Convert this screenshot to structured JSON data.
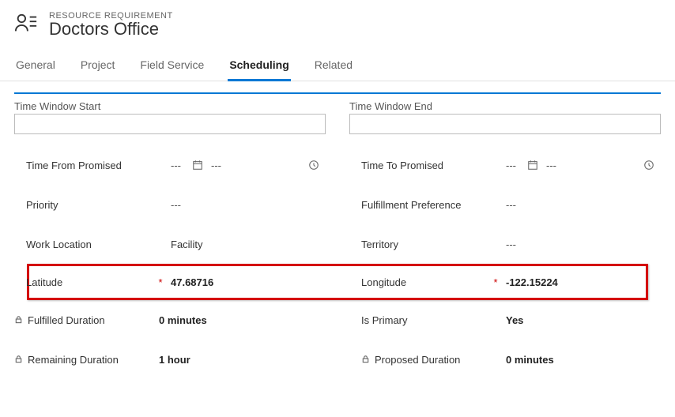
{
  "header": {
    "eyebrow": "RESOURCE REQUIREMENT",
    "title": "Doctors Office"
  },
  "tabs": [
    {
      "label": "General",
      "active": false
    },
    {
      "label": "Project",
      "active": false
    },
    {
      "label": "Field Service",
      "active": false
    },
    {
      "label": "Scheduling",
      "active": true
    },
    {
      "label": "Related",
      "active": false
    }
  ],
  "sections": {
    "left": {
      "label": "Time Window Start",
      "value": ""
    },
    "right": {
      "label": "Time Window End",
      "value": ""
    }
  },
  "fields": {
    "left": {
      "timeFromPromised": {
        "label": "Time From Promised",
        "date": "---",
        "time": "---"
      },
      "priority": {
        "label": "Priority",
        "value": "---"
      },
      "workLocation": {
        "label": "Work Location",
        "value": "Facility"
      },
      "latitude": {
        "label": "Latitude",
        "value": "47.68716",
        "required": true
      },
      "fulfilled": {
        "label": "Fulfilled Duration",
        "value": "0 minutes",
        "locked": true
      },
      "remaining": {
        "label": "Remaining Duration",
        "value": "1 hour",
        "locked": true
      }
    },
    "right": {
      "timeToPromised": {
        "label": "Time To Promised",
        "date": "---",
        "time": "---"
      },
      "fulfillPref": {
        "label": "Fulfillment Preference",
        "value": "---"
      },
      "territory": {
        "label": "Territory",
        "value": "---"
      },
      "longitude": {
        "label": "Longitude",
        "value": "-122.15224",
        "required": true
      },
      "isPrimary": {
        "label": "Is Primary",
        "value": "Yes"
      },
      "proposed": {
        "label": "Proposed Duration",
        "value": "0 minutes",
        "locked": true
      }
    }
  }
}
